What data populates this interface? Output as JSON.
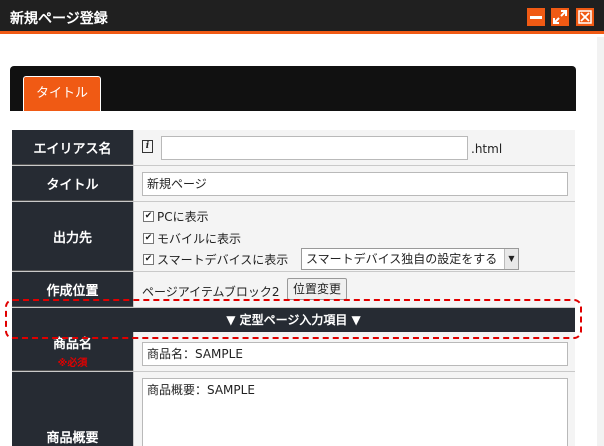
{
  "window": {
    "title": "新規ページ登録",
    "minimize_icon": "minimize-icon",
    "maximize_icon": "maximize-icon",
    "close_icon": "close-icon"
  },
  "tabs": [
    {
      "label": "タイトル",
      "active": true
    }
  ],
  "fields": {
    "alias": {
      "label": "エイリアス名",
      "value": "",
      "suffix": ".html",
      "icon": "info-icon"
    },
    "title": {
      "label": "タイトル",
      "value": "新規ページ"
    },
    "output": {
      "label": "出力先",
      "options": [
        {
          "label": "PCに表示",
          "checked": true
        },
        {
          "label": "モバイルに表示",
          "checked": true
        },
        {
          "label": "スマートデバイスに表示",
          "checked": true
        }
      ],
      "smart_select": "スマートデバイス独自の設定をする"
    },
    "position": {
      "label": "作成位置",
      "value": "ページアイテムブロック2",
      "button": "位置変更"
    },
    "section_header": "▼ 定型ページ入力項目 ▼",
    "product_name": {
      "label": "商品名",
      "required": "※必須",
      "value": "商品名：SAMPLE"
    },
    "product_summary": {
      "label": "商品概要",
      "value": "商品概要：SAMPLE"
    }
  },
  "colors": {
    "accent": "#f05a14",
    "label_bg": "#262b33",
    "highlight": "#e00000"
  }
}
